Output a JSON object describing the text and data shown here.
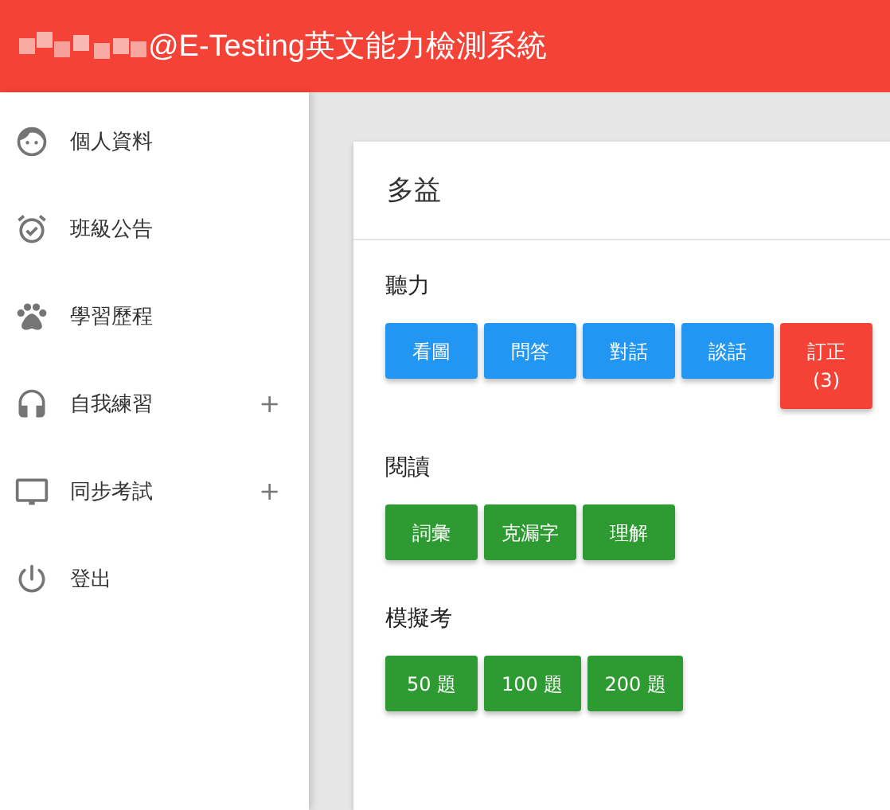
{
  "header": {
    "title": "@E-Testing英文能力檢測系統"
  },
  "sidebar": {
    "items": [
      {
        "label": "個人資料"
      },
      {
        "label": "班級公告"
      },
      {
        "label": "學習歷程"
      },
      {
        "label": "自我練習",
        "toggle": "+"
      },
      {
        "label": "同步考試",
        "toggle": "+"
      },
      {
        "label": "登出"
      }
    ]
  },
  "card": {
    "title": "多益",
    "sections": [
      {
        "heading": "聽力",
        "buttons": [
          {
            "label": "看圖",
            "kind": "primary"
          },
          {
            "label": "問答",
            "kind": "primary"
          },
          {
            "label": "對話",
            "kind": "primary"
          },
          {
            "label": "談話",
            "kind": "primary"
          },
          {
            "label": "訂正\n(3)",
            "kind": "danger"
          }
        ]
      },
      {
        "heading": "閱讀",
        "buttons": [
          {
            "label": "詞彙",
            "kind": "success"
          },
          {
            "label": "克漏字",
            "kind": "success"
          },
          {
            "label": "理解",
            "kind": "success"
          }
        ]
      },
      {
        "heading": "模擬考",
        "buttons": [
          {
            "label": "50 題",
            "kind": "success"
          },
          {
            "label": "100 題",
            "kind": "success"
          },
          {
            "label": "200 題",
            "kind": "success"
          }
        ]
      }
    ]
  }
}
